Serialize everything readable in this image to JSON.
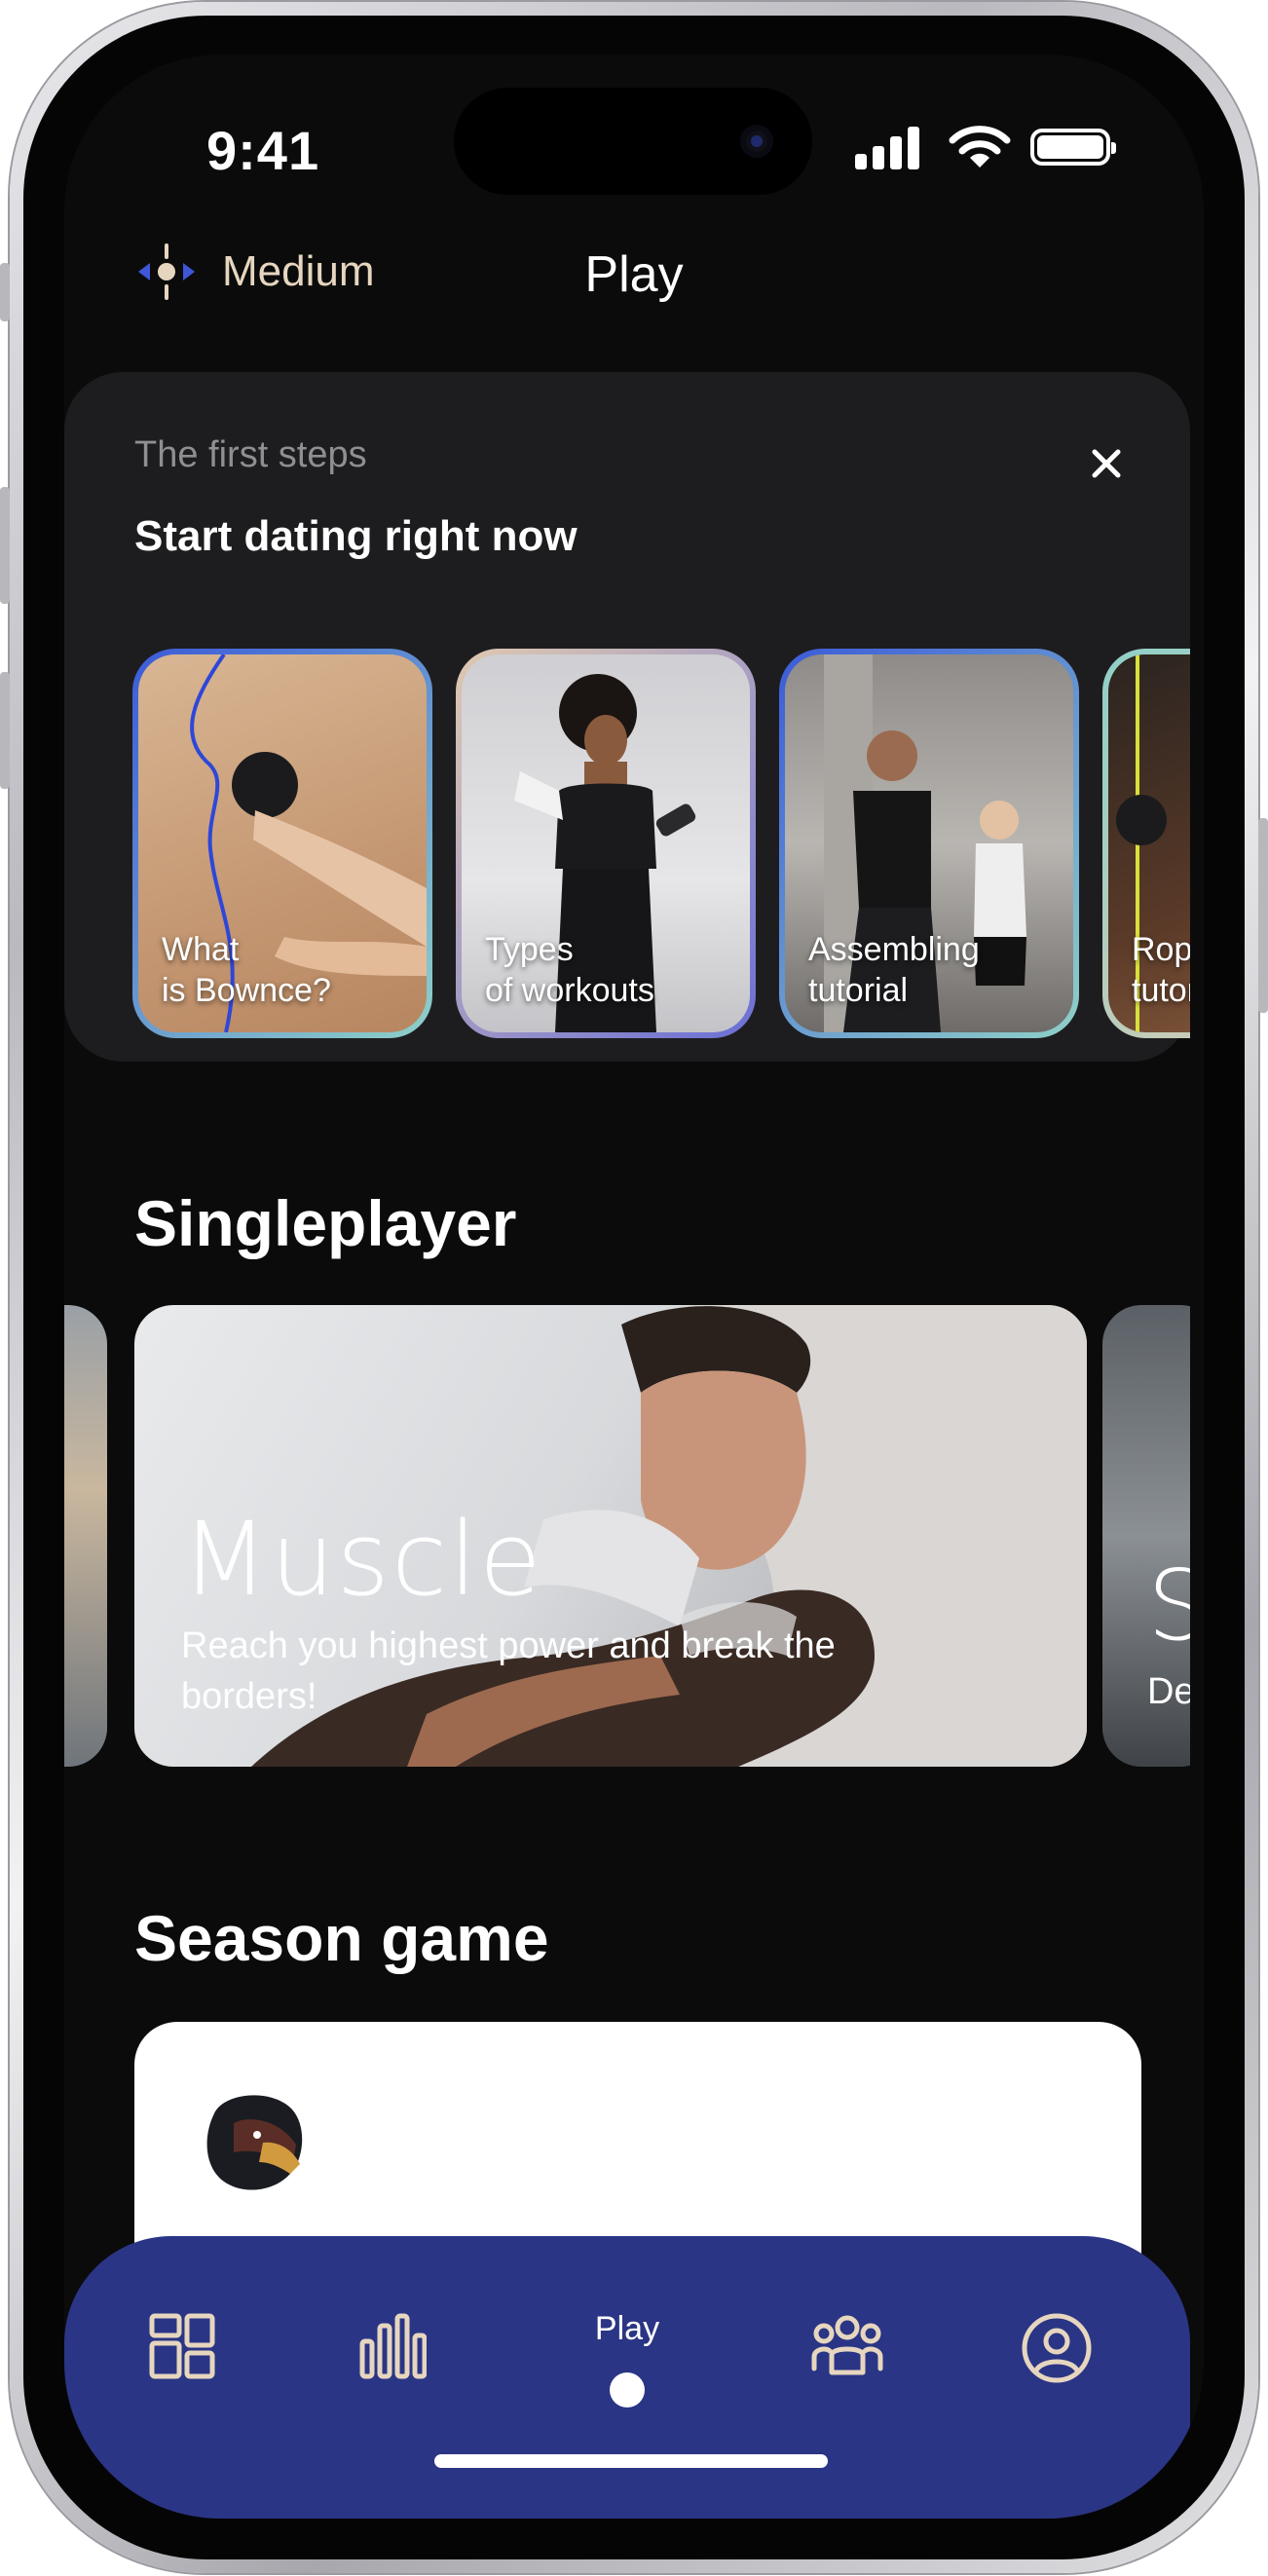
{
  "status_bar": {
    "time": "9:41"
  },
  "header": {
    "level_label": "Medium",
    "title": "Play"
  },
  "first_steps": {
    "subtitle": "The first steps",
    "title": "Start dating right now",
    "stories": [
      {
        "label": "What\nis Bownce?"
      },
      {
        "label": "Types\nof workouts"
      },
      {
        "label": "Assembling\ntutorial"
      },
      {
        "label": "Rope\ntutorial"
      }
    ]
  },
  "singleplayer": {
    "title": "Singleplayer",
    "featured": {
      "title": "Muscle",
      "description": "Reach you highest power and break the borders!"
    },
    "next_peek": {
      "title": "S",
      "description": "De"
    }
  },
  "season": {
    "title": "Season game"
  },
  "tabbar": {
    "play_label": "Play",
    "icons": [
      "dashboard-icon",
      "stats-icon",
      "play-dot-icon",
      "community-icon",
      "profile-icon"
    ]
  },
  "colors": {
    "accent_gold": "#e6d6bf",
    "tabbar_blue": "#2b3585",
    "background": "#0b0b0b",
    "card": "#1d1d1f"
  }
}
